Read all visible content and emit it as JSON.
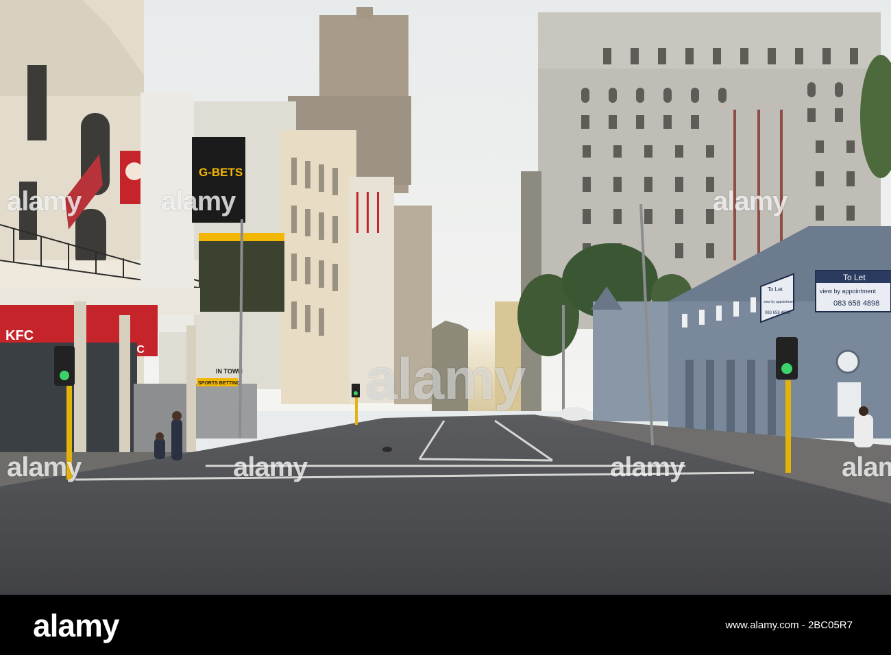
{
  "photo": {
    "signs": {
      "kfc_left": "KFC",
      "kfc_right": "KFC",
      "gbets": "G-BETS",
      "sports_betting": "SPORTS BETTING",
      "in_town": "IN TOWN",
      "to_let_large": "To Let",
      "view_by": "view by appointment",
      "phone_large": "083 658 4898",
      "to_let_small": "To Let",
      "view_by_small": "view by appointment",
      "phone_small": "083 658 4898"
    },
    "watermarks": {
      "center": "alamy",
      "left": "alamy",
      "middle_left": "alamy",
      "middle_right": "alamy",
      "right": "alamy",
      "top_left": "alamy",
      "top_right": "alamy",
      "top_mid": "alamy"
    }
  },
  "footer": {
    "logo": "alamy",
    "stock_id": "www.alamy.com - 2BC05R7"
  },
  "colors": {
    "sky": "#eef0ef",
    "road": "#4a4b4f",
    "kfc_red": "#c6242b",
    "gbets_black": "#1b1b1b",
    "gbets_yellow": "#f2b705",
    "blue_building": "#6d7b8f",
    "footer_bg": "#000000"
  }
}
